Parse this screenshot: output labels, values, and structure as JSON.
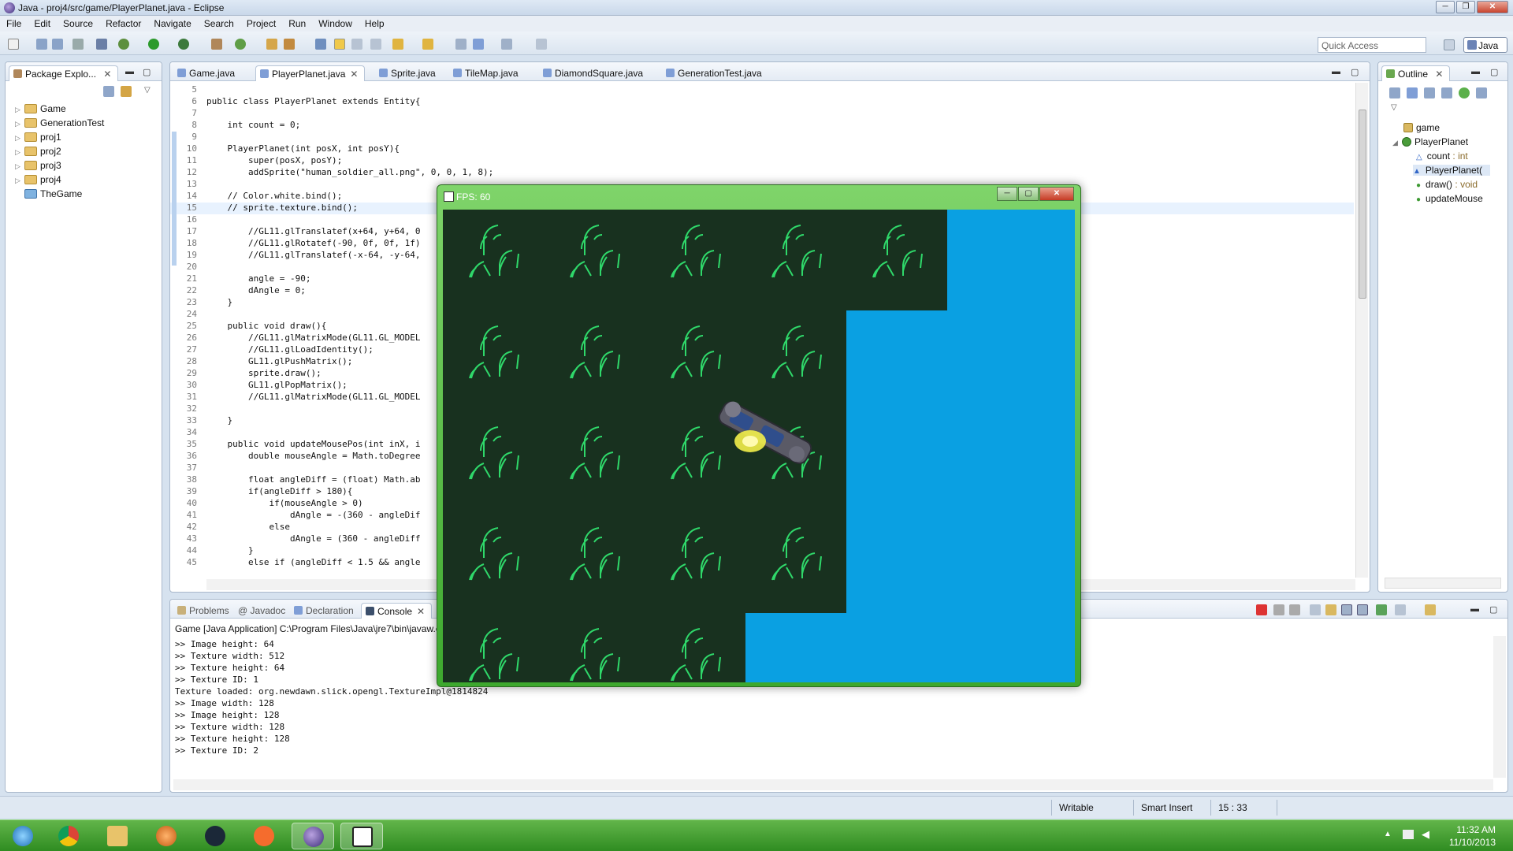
{
  "window": {
    "title": "Java - proj4/src/game/PlayerPlanet.java - Eclipse"
  },
  "menu": [
    "File",
    "Edit",
    "Source",
    "Refactor",
    "Navigate",
    "Search",
    "Project",
    "Run",
    "Window",
    "Help"
  ],
  "toolbar": {
    "quick_access": "Quick Access",
    "perspective": "Java"
  },
  "package_explorer": {
    "tab_label": "Package Explo...",
    "items": [
      {
        "label": "Game",
        "expandable": true
      },
      {
        "label": "GenerationTest",
        "expandable": true
      },
      {
        "label": "proj1",
        "expandable": true
      },
      {
        "label": "proj2",
        "expandable": true
      },
      {
        "label": "proj3",
        "expandable": true
      },
      {
        "label": "proj4",
        "expandable": true
      },
      {
        "label": "TheGame",
        "expandable": false
      }
    ]
  },
  "editor": {
    "tabs": [
      {
        "label": "Game.java",
        "active": false
      },
      {
        "label": "PlayerPlanet.java",
        "active": true
      },
      {
        "label": "Sprite.java",
        "active": false
      },
      {
        "label": "TileMap.java",
        "active": false
      },
      {
        "label": "DiamondSquare.java",
        "active": false
      },
      {
        "label": "GenerationTest.java",
        "active": false
      }
    ],
    "lines": [
      {
        "n": "5",
        "t": ""
      },
      {
        "n": "6",
        "t": "public class PlayerPlanet extends Entity{"
      },
      {
        "n": "7",
        "t": ""
      },
      {
        "n": "8",
        "t": "    int count = 0;"
      },
      {
        "n": "9",
        "t": ""
      },
      {
        "n": "10",
        "t": "    PlayerPlanet(int posX, int posY){"
      },
      {
        "n": "11",
        "t": "        super(posX, posY);"
      },
      {
        "n": "12",
        "t": "        addSprite(\"human_soldier_all.png\", 0, 0, 1, 8);"
      },
      {
        "n": "13",
        "t": ""
      },
      {
        "n": "14",
        "t": "    // Color.white.bind();"
      },
      {
        "n": "15",
        "t": "    // sprite.texture.bind();"
      },
      {
        "n": "16",
        "t": ""
      },
      {
        "n": "17",
        "t": "        //GL11.glTranslatef(x+64, y+64, 0"
      },
      {
        "n": "18",
        "t": "        //GL11.glRotatef(-90, 0f, 0f, 1f)"
      },
      {
        "n": "19",
        "t": "        //GL11.glTranslatef(-x-64, -y-64,"
      },
      {
        "n": "20",
        "t": ""
      },
      {
        "n": "21",
        "t": "        angle = -90;"
      },
      {
        "n": "22",
        "t": "        dAngle = 0;"
      },
      {
        "n": "23",
        "t": "    }"
      },
      {
        "n": "24",
        "t": ""
      },
      {
        "n": "25",
        "t": "    public void draw(){"
      },
      {
        "n": "26",
        "t": "        //GL11.glMatrixMode(GL11.GL_MODEL"
      },
      {
        "n": "27",
        "t": "        //GL11.glLoadIdentity();"
      },
      {
        "n": "28",
        "t": "        GL11.glPushMatrix();"
      },
      {
        "n": "29",
        "t": "        sprite.draw();"
      },
      {
        "n": "30",
        "t": "        GL11.glPopMatrix();"
      },
      {
        "n": "31",
        "t": "        //GL11.glMatrixMode(GL11.GL_MODEL"
      },
      {
        "n": "32",
        "t": ""
      },
      {
        "n": "33",
        "t": "    }"
      },
      {
        "n": "34",
        "t": ""
      },
      {
        "n": "35",
        "t": "    public void updateMousePos(int inX, i"
      },
      {
        "n": "36",
        "t": "        double mouseAngle = Math.toDegree"
      },
      {
        "n": "37",
        "t": ""
      },
      {
        "n": "38",
        "t": "        float angleDiff = (float) Math.ab"
      },
      {
        "n": "39",
        "t": "        if(angleDiff > 180){"
      },
      {
        "n": "40",
        "t": "            if(mouseAngle > 0)"
      },
      {
        "n": "41",
        "t": "                dAngle = -(360 - angleDif"
      },
      {
        "n": "42",
        "t": "            else"
      },
      {
        "n": "43",
        "t": "                dAngle = (360 - angleDiff"
      },
      {
        "n": "44",
        "t": "        }"
      },
      {
        "n": "45",
        "t": "        else if (angleDiff < 1.5 && angle"
      }
    ]
  },
  "outline": {
    "tab_label": "Outline",
    "items": [
      {
        "label": "game",
        "detail": ""
      },
      {
        "label": "PlayerPlanet",
        "detail": ""
      },
      {
        "label": "count",
        "detail": " : int"
      },
      {
        "label": "PlayerPlanet(",
        "detail": ""
      },
      {
        "label": "draw()",
        "detail": " : void"
      },
      {
        "label": "updateMouse",
        "detail": ""
      }
    ]
  },
  "console": {
    "tabs": [
      {
        "label": "Problems",
        "active": false
      },
      {
        "label": "@ Javadoc",
        "active": false
      },
      {
        "label": "Declaration",
        "active": false
      },
      {
        "label": "Console",
        "active": true
      }
    ],
    "header": "Game [Java Application] C:\\Program Files\\Java\\jre7\\bin\\javaw.e",
    "lines": [
      ">> Image height: 64",
      ">> Texture width: 512",
      ">> Texture height: 64",
      ">> Texture ID: 1",
      "Texture loaded: org.newdawn.slick.opengl.TextureImpl@1814824",
      ">> Image width: 128",
      ">> Image height: 128",
      ">> Texture width: 128",
      ">> Texture height: 128",
      ">> Texture ID: 2"
    ]
  },
  "game_window": {
    "title": "FPS: 60",
    "water_color": "#0aa0e2",
    "grass_color": "#18311f",
    "grass_rows": [
      5,
      4,
      4,
      4,
      3
    ]
  },
  "status": {
    "writable": "Writable",
    "insert_mode": "Smart Insert",
    "position": "15 : 33"
  },
  "taskbar": {
    "time": "11:32 AM",
    "date": "11/10/2013"
  }
}
